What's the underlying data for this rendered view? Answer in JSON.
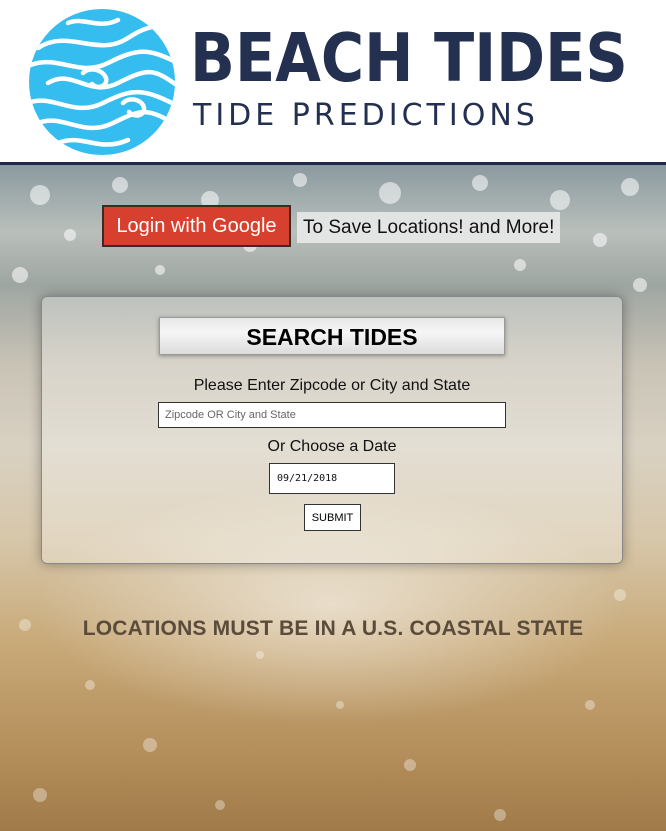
{
  "header": {
    "logo_icon": "tide-swirl-logo",
    "title": "BEACH TIDES",
    "subtitle": "TIDE PREDICTIONS",
    "colors": {
      "title": "#24304f",
      "logo": "#35bdf0"
    }
  },
  "login": {
    "button_label": "Login with Google",
    "note": "To Save Locations! and More!",
    "button_color": "#d7402f"
  },
  "search": {
    "title": "SEARCH TIDES",
    "location_label": "Please Enter Zipcode or City and State",
    "location_placeholder": "Zipcode OR City and State",
    "location_value": "",
    "date_label": "Or Choose a Date",
    "date_value": "09/21/2018",
    "submit_label": "SUBMIT"
  },
  "notice": "LOCATIONS MUST BE IN A U.S. COASTAL STATE"
}
